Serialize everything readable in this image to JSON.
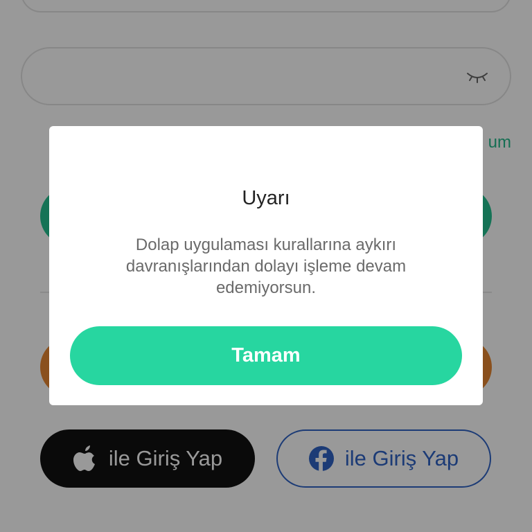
{
  "background": {
    "forgot_link_fragment": "um",
    "password_toggle_icon": "eye-closed-icon",
    "apple_login": {
      "icon": "apple-icon",
      "label": "ile Giriş Yap"
    },
    "facebook_login": {
      "icon": "facebook-icon",
      "label": "ile Giriş Yap"
    },
    "colors": {
      "primary_green": "#23c08f",
      "signup_orange": "#e68531",
      "apple_black": "#111111",
      "facebook_blue": "#2f63c5"
    }
  },
  "dialog": {
    "title": "Uyarı",
    "message": "Dolap uygulaması kurallarına aykırı davranışlarından dolayı işleme devam edemiyorsun.",
    "ok_button": "Tamam",
    "button_color": "#27d6a0"
  }
}
